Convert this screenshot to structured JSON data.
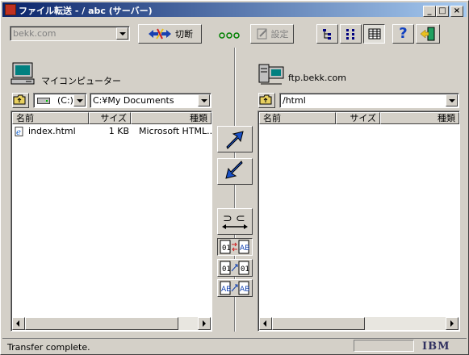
{
  "window": {
    "title": "ファイル転送 - / abc (サーバー)"
  },
  "toolbar": {
    "host_combo": "bekk.com",
    "disconnect_label": "切断",
    "settings_label": "設定"
  },
  "local": {
    "label": "マイコンピューター",
    "drive": "(C:)",
    "path": "C:¥My Documents",
    "columns": [
      "名前",
      "サイズ",
      "種類"
    ],
    "rows": [
      {
        "name": "index.html",
        "size": "1 KB",
        "type": "Microsoft HTML..."
      }
    ]
  },
  "remote": {
    "label": "ftp.bekk.com",
    "path": "/html",
    "columns": [
      "名前",
      "サイズ",
      "種類"
    ],
    "rows": []
  },
  "status": {
    "text": "Transfer complete.",
    "brand": "IBM"
  },
  "colors": {
    "title_start": "#0a246a",
    "title_end": "#a6caf0",
    "face": "#d4d0c8",
    "upload_arrow": "#1850c8"
  }
}
